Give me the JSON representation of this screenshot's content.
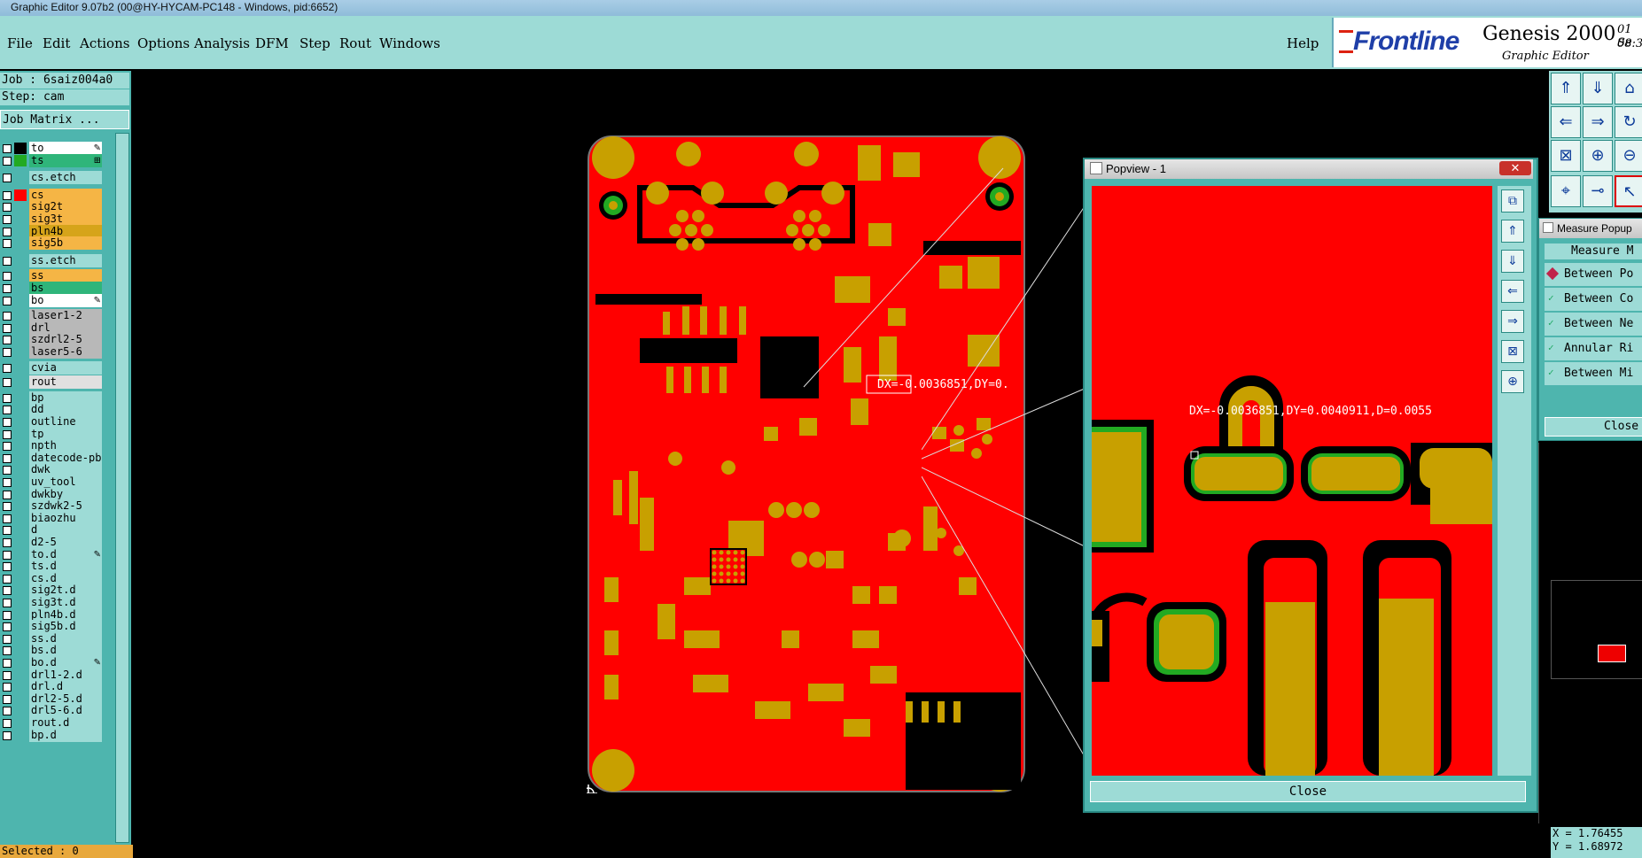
{
  "titlebar": {
    "text": "Graphic Editor 9.07b2 (00@HY-HYCAM-PC148 - Windows, pid:6652)"
  },
  "menu": {
    "items": [
      "File",
      "Edit",
      "Actions",
      "Options",
      "Analysis",
      "DFM",
      "Step",
      "Rout",
      "Windows"
    ],
    "help": "Help"
  },
  "brand": {
    "logo": "Frontline",
    "product": "Genesis 2000",
    "subtitle": "Graphic Editor",
    "date_line1": "01 Se",
    "date_line2": "08:3"
  },
  "job": {
    "job_label": "Job : 6saiz004a0",
    "step_label": "Step: cam",
    "matrix_button": "Job Matrix ..."
  },
  "layers": [
    {
      "name": "to",
      "swatch": "#000000",
      "bg": "#ffffff",
      "mark": "✎"
    },
    {
      "name": "ts",
      "swatch": "#22aa22",
      "bg": "#2fb57a",
      "mark": "⊞"
    },
    {
      "name": "cs.etch",
      "swatch": "",
      "bg": "#9ddbd6",
      "mark": ""
    },
    {
      "name": "cs",
      "swatch": "#ff0000",
      "bg": "#f5b545",
      "mark": ""
    },
    {
      "name": "sig2t",
      "swatch": "",
      "bg": "#f5b545",
      "mark": ""
    },
    {
      "name": "sig3t",
      "swatch": "",
      "bg": "#f5b545",
      "mark": ""
    },
    {
      "name": "pln4b",
      "swatch": "",
      "bg": "#d6a41a",
      "mark": ""
    },
    {
      "name": "sig5b",
      "swatch": "",
      "bg": "#f5b545",
      "mark": ""
    },
    {
      "name": "ss.etch",
      "swatch": "",
      "bg": "#9ddbd6",
      "mark": ""
    },
    {
      "name": "ss",
      "swatch": "",
      "bg": "#f5b545",
      "mark": ""
    },
    {
      "name": "bs",
      "swatch": "",
      "bg": "#2fb57a",
      "mark": ""
    },
    {
      "name": "bo",
      "swatch": "",
      "bg": "#ffffff",
      "mark": "✎"
    },
    {
      "name": "laser1-2",
      "swatch": "",
      "bg": "#b8b8b8",
      "mark": ""
    },
    {
      "name": "drl",
      "swatch": "",
      "bg": "#b8b8b8",
      "mark": ""
    },
    {
      "name": "szdrl2-5",
      "swatch": "",
      "bg": "#b8b8b8",
      "mark": ""
    },
    {
      "name": "laser5-6",
      "swatch": "",
      "bg": "#b8b8b8",
      "mark": ""
    },
    {
      "name": "cvia",
      "swatch": "",
      "bg": "#9ddbd6",
      "mark": ""
    },
    {
      "name": "rout",
      "swatch": "",
      "bg": "#e0e0e0",
      "mark": ""
    },
    {
      "name": "bp",
      "swatch": "",
      "bg": "#9ddbd6",
      "mark": ""
    },
    {
      "name": "dd",
      "swatch": "",
      "bg": "#9ddbd6",
      "mark": ""
    },
    {
      "name": "outline",
      "swatch": "",
      "bg": "#9ddbd6",
      "mark": ""
    },
    {
      "name": "tp",
      "swatch": "",
      "bg": "#9ddbd6",
      "mark": ""
    },
    {
      "name": "npth",
      "swatch": "",
      "bg": "#9ddbd6",
      "mark": ""
    },
    {
      "name": "datecode-pbe",
      "swatch": "",
      "bg": "#9ddbd6",
      "mark": ""
    },
    {
      "name": "dwk",
      "swatch": "",
      "bg": "#9ddbd6",
      "mark": ""
    },
    {
      "name": "uv_tool",
      "swatch": "",
      "bg": "#9ddbd6",
      "mark": ""
    },
    {
      "name": "dwkby",
      "swatch": "",
      "bg": "#9ddbd6",
      "mark": ""
    },
    {
      "name": "szdwk2-5",
      "swatch": "",
      "bg": "#9ddbd6",
      "mark": ""
    },
    {
      "name": "biaozhu",
      "swatch": "",
      "bg": "#9ddbd6",
      "mark": ""
    },
    {
      "name": "d",
      "swatch": "",
      "bg": "#9ddbd6",
      "mark": ""
    },
    {
      "name": "d2-5",
      "swatch": "",
      "bg": "#9ddbd6",
      "mark": ""
    },
    {
      "name": "to.d",
      "swatch": "",
      "bg": "#9ddbd6",
      "mark": "✎"
    },
    {
      "name": "ts.d",
      "swatch": "",
      "bg": "#9ddbd6",
      "mark": ""
    },
    {
      "name": "cs.d",
      "swatch": "",
      "bg": "#9ddbd6",
      "mark": ""
    },
    {
      "name": "sig2t.d",
      "swatch": "",
      "bg": "#9ddbd6",
      "mark": ""
    },
    {
      "name": "sig3t.d",
      "swatch": "",
      "bg": "#9ddbd6",
      "mark": ""
    },
    {
      "name": "pln4b.d",
      "swatch": "",
      "bg": "#9ddbd6",
      "mark": ""
    },
    {
      "name": "sig5b.d",
      "swatch": "",
      "bg": "#9ddbd6",
      "mark": ""
    },
    {
      "name": "ss.d",
      "swatch": "",
      "bg": "#9ddbd6",
      "mark": ""
    },
    {
      "name": "bs.d",
      "swatch": "",
      "bg": "#9ddbd6",
      "mark": ""
    },
    {
      "name": "bo.d",
      "swatch": "",
      "bg": "#9ddbd6",
      "mark": "✎"
    },
    {
      "name": "drl1-2.d",
      "swatch": "",
      "bg": "#9ddbd6",
      "mark": ""
    },
    {
      "name": "drl.d",
      "swatch": "",
      "bg": "#9ddbd6",
      "mark": ""
    },
    {
      "name": "drl2-5.d",
      "swatch": "",
      "bg": "#9ddbd6",
      "mark": ""
    },
    {
      "name": "drl5-6.d",
      "swatch": "",
      "bg": "#9ddbd6",
      "mark": ""
    },
    {
      "name": "rout.d",
      "swatch": "",
      "bg": "#9ddbd6",
      "mark": ""
    },
    {
      "name": "bp.d",
      "swatch": "",
      "bg": "#9ddbd6",
      "mark": ""
    }
  ],
  "status": {
    "selected": "Selected : 0"
  },
  "board": {
    "measure_label": "DX=-0.0036851,DY=0.",
    "copper_color": "#ff0000",
    "pad_color": "#c8a000",
    "via_color": "#22aa22"
  },
  "popview": {
    "title": "Popview - 1",
    "close_x": "✕",
    "measure_label": "DX=-0.0036851,DY=0.0040911,D=0.0055",
    "close_button": "Close"
  },
  "measure_popup": {
    "title": "Measure Popup",
    "header": "Measure M",
    "options": [
      "Between Po",
      "Between Co",
      "Between Ne",
      "Annular Ri",
      "Between Mi"
    ],
    "close": "Close"
  },
  "coords": {
    "x": "X = 1.76455",
    "y": "Y = 1.68972"
  }
}
